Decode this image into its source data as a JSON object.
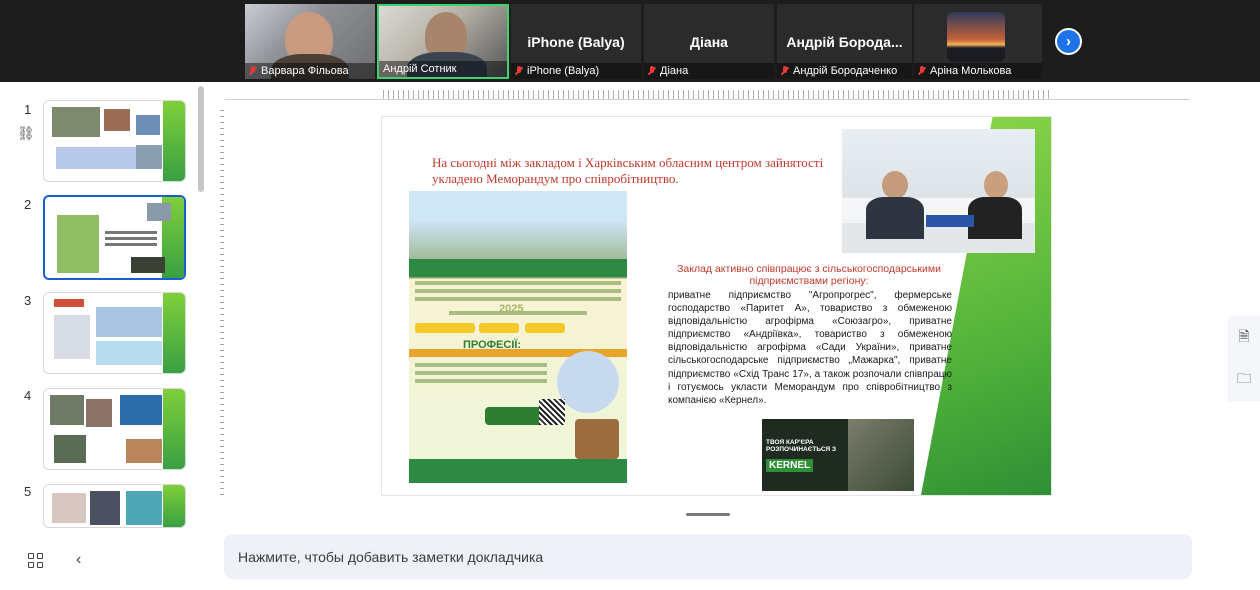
{
  "participants": [
    {
      "name": "Варвара Фільова",
      "type": "video"
    },
    {
      "name": "Андрій Сотник",
      "type": "video",
      "active_speaker": true
    },
    {
      "name": "iPhone (Balya)",
      "display": "iPhone (Balya)",
      "type": "text"
    },
    {
      "name": "Діана",
      "display": "Діана",
      "type": "text"
    },
    {
      "name": "Андрій Бородаченко",
      "display": "Андрій Борода...",
      "type": "text"
    },
    {
      "name": "Аріна Молькова",
      "type": "avatar"
    }
  ],
  "nav": {
    "next_icon": "chevron-right-icon"
  },
  "slides": [
    {
      "num": "1"
    },
    {
      "num": "2",
      "active": true
    },
    {
      "num": "3"
    },
    {
      "num": "4"
    },
    {
      "num": "5"
    }
  ],
  "slide": {
    "title": "На сьогодні між закладом і  Харківським обласним центром зайнятості укладено Меморандум про співробітництво.",
    "subtitle": "Заклад активно співпрацює з сільськогосподарськими підприємствами регіону:",
    "body": "приватне підприємство \"Агропрогрес\", фермерське господарство «Паритет А», товариство з обмеженою відповідальністю агрофірма «Союзагро», приватне підприємство «Андріївка», товариство з обмеженою відповідальністю агрофірма «Сади України», приватне сільськогосподарське підприємство „Мажарка\", приватне підприємство «Схід Транс 17», а також розпочали співпрацю і готуємось укласти Меморандум про співробітництво з компанією «Кернел».",
    "poster_heading": "ПРОФЕСІЇ:",
    "poster_year": "2025",
    "kernel_caption": "ТВОЯ КАР'ЄРА РОЗПОЧИНАЄТЬСЯ З",
    "kernel_logo": "KERNEL"
  },
  "notes": {
    "placeholder": "Нажмите, чтобы добавить заметки докладчика"
  },
  "colors": {
    "accent_green": "#52b33a",
    "title_red": "#c0392b",
    "active_border": "#1a5fd0",
    "next_button": "#1e73e8"
  }
}
